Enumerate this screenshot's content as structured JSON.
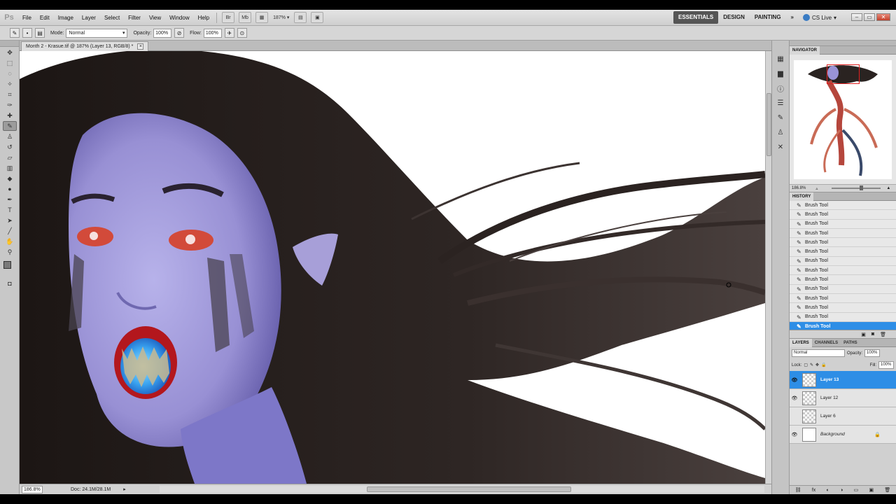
{
  "app": {
    "logo": "Ps"
  },
  "menu": [
    "File",
    "Edit",
    "Image",
    "Layer",
    "Select",
    "Filter",
    "View",
    "Window",
    "Help"
  ],
  "menubar_controls": {
    "zoom": "187%"
  },
  "workspaces": [
    "ESSENTIALS",
    "DESIGN",
    "PAINTING"
  ],
  "workspace_more": "»",
  "cs_live": "CS Live",
  "options": {
    "mode_label": "Mode:",
    "mode_value": "Normal",
    "opacity_label": "Opacity:",
    "opacity_value": "100%",
    "flow_label": "Flow:",
    "flow_value": "100%"
  },
  "document": {
    "tab_title": "Month 2 - Krasue.tif @ 187% (Layer 13, RGB/8) *",
    "status_zoom": "186.8%",
    "status_doc": "Doc: 24.1M/28.1M"
  },
  "navigator": {
    "title": "NAVIGATOR",
    "zoom": "186.8%"
  },
  "history": {
    "title": "HISTORY",
    "items": [
      "Brush Tool",
      "Brush Tool",
      "Brush Tool",
      "Brush Tool",
      "Brush Tool",
      "Brush Tool",
      "Brush Tool",
      "Brush Tool",
      "Brush Tool",
      "Brush Tool",
      "Brush Tool",
      "Brush Tool",
      "Brush Tool",
      "Brush Tool"
    ]
  },
  "layers_panel": {
    "tabs": [
      "LAYERS",
      "CHANNELS",
      "PATHS"
    ],
    "blend_mode": "Normal",
    "opacity_label": "Opacity:",
    "opacity_value": "100%",
    "lock_label": "Lock:",
    "fill_label": "Fill:",
    "fill_value": "100%",
    "layers": [
      {
        "name": "Layer 13",
        "visible": true,
        "selected": true
      },
      {
        "name": "Layer 12",
        "visible": true,
        "selected": false
      },
      {
        "name": "Layer 6",
        "visible": false,
        "selected": false
      },
      {
        "name": "Background",
        "visible": true,
        "selected": false
      }
    ]
  },
  "colors": {
    "selection": "#2e8ee6",
    "hair": "#2a2321",
    "skin": "#9a93d6",
    "canvas": "#ffffff"
  }
}
